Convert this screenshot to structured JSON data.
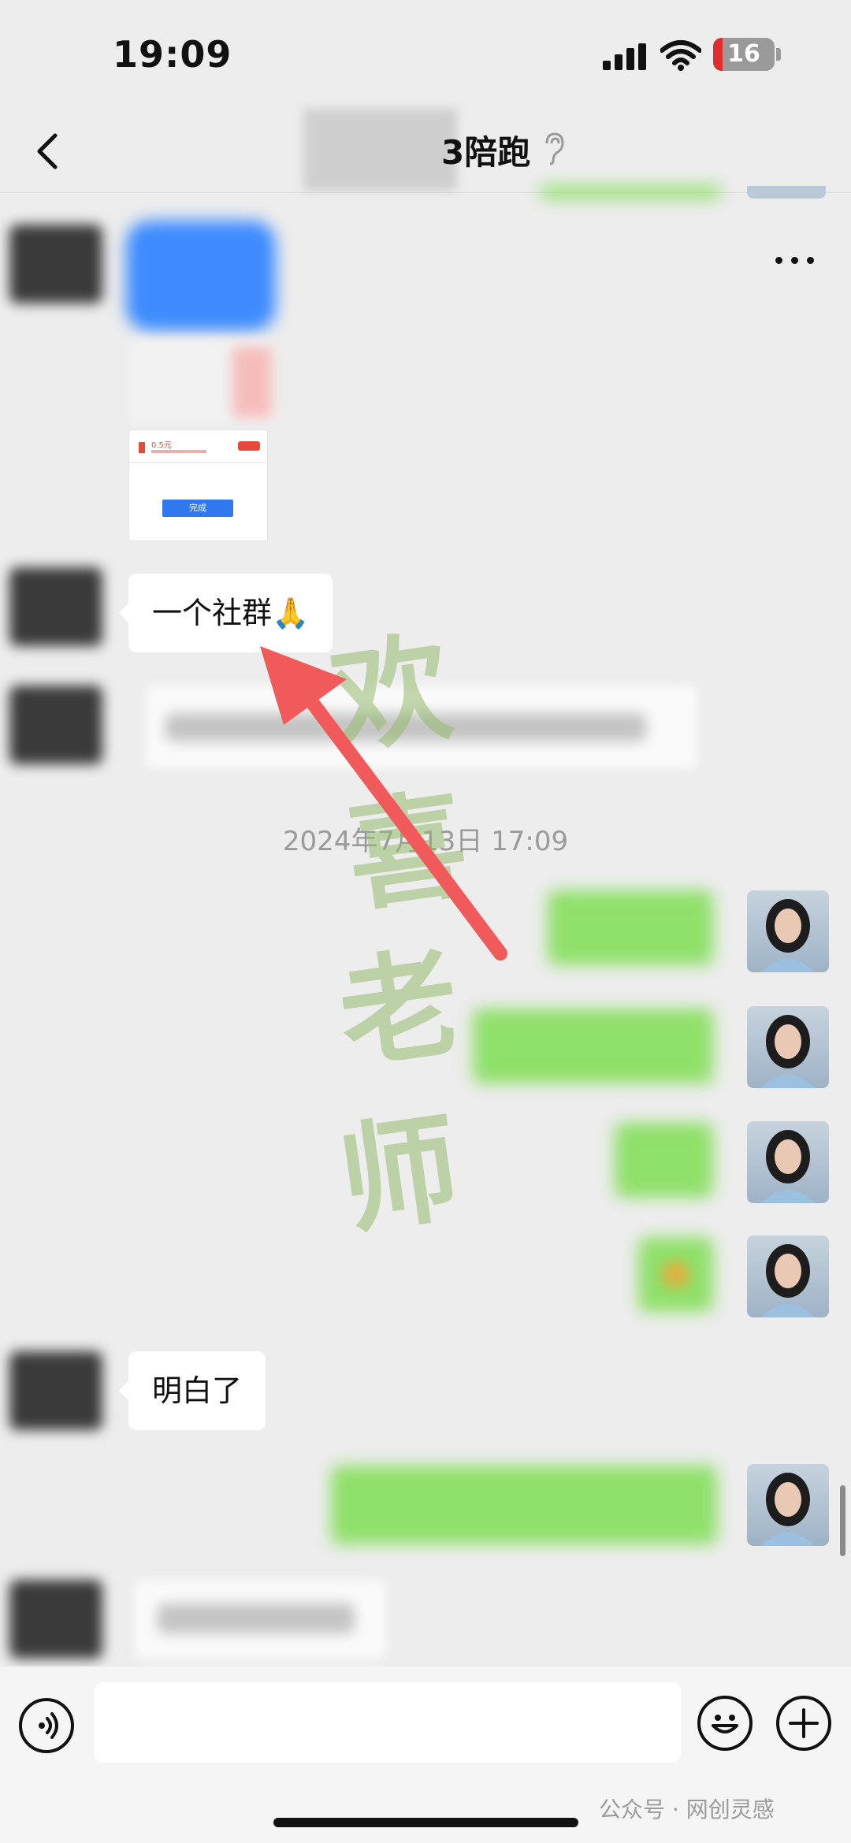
{
  "status_bar": {
    "time": "19:09",
    "battery": "16"
  },
  "nav": {
    "title_visible": "3陪跑",
    "back_icon": "chevron-left-icon",
    "more_icon": "ellipsis-icon",
    "ear_icon": "ear-icon"
  },
  "messages": {
    "shared_card": {
      "amount": "0.5元",
      "button": "完成"
    },
    "incoming_1": "一个社群🙏",
    "timestamp": "2024年7月13日 17:09",
    "incoming_2": "明白了"
  },
  "watermark": {
    "chars": [
      "欢",
      "喜",
      "老",
      "师"
    ]
  },
  "input_bar": {
    "placeholder": "",
    "voice_icon": "voice-icon",
    "emoji_icon": "emoji-icon",
    "plus_icon": "plus-icon"
  },
  "footer": {
    "credit": "公众号 · 网创灵感"
  },
  "colors": {
    "background": "#ededed",
    "my_bubble": "#95ec69",
    "arrow": "#f05a5a"
  }
}
